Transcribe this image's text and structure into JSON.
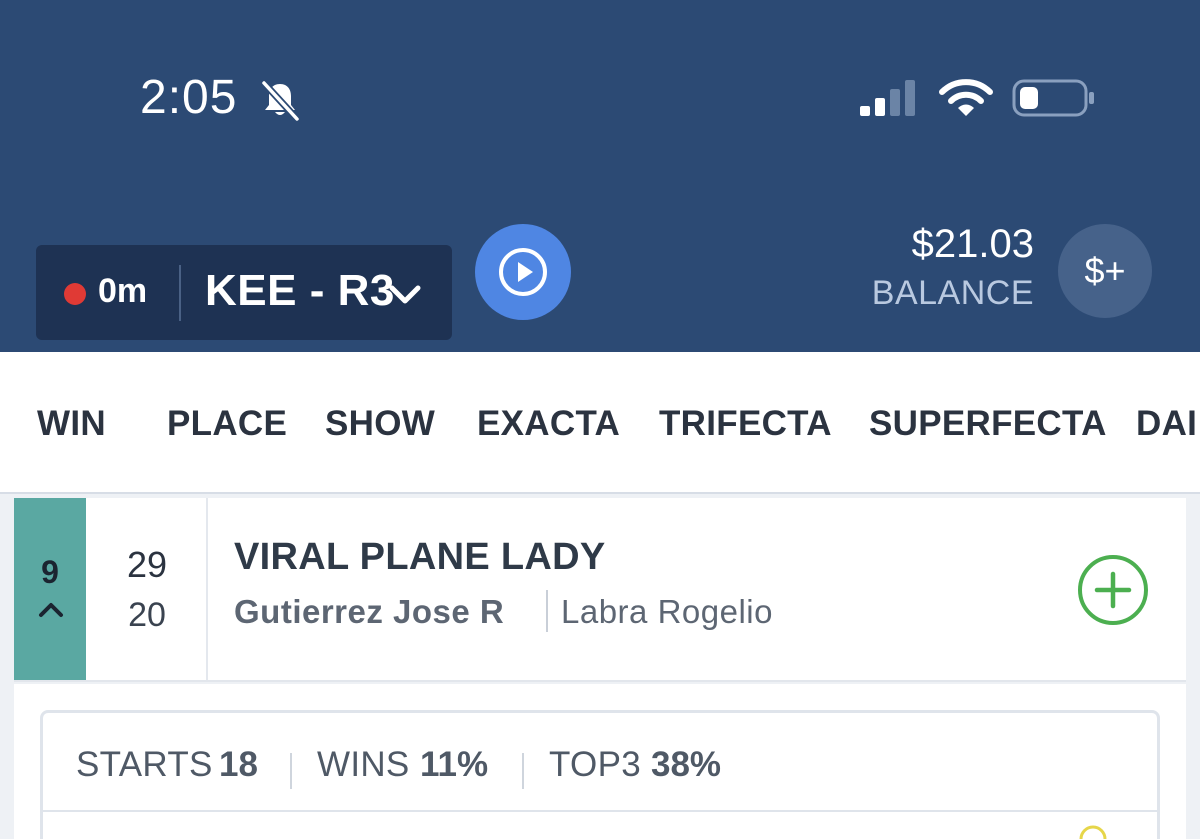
{
  "status_bar": {
    "time": "2:05",
    "icons": [
      "bell-slash-icon",
      "signal-icon",
      "wifi-icon",
      "battery-icon"
    ]
  },
  "race_selector": {
    "mtp": "0m",
    "race": "KEE - R3",
    "status_color": "#e03a35"
  },
  "balance": {
    "amount": "$21.03",
    "label": "BALANCE",
    "deposit_label": "$+"
  },
  "bet_tabs": [
    "WIN",
    "PLACE",
    "SHOW",
    "EXACTA",
    "TRIFECTA",
    "SUPERFECTA",
    "DAI"
  ],
  "runner": {
    "post": "9",
    "odds_numerator": "29",
    "odds_denominator": "20",
    "name": "VIRAL PLANE LADY",
    "jockey": "Gutierrez Jose R",
    "trainer": "Labra Rogelio",
    "post_color": "#5aa8a2"
  },
  "stats": {
    "starts_label": "STARTS",
    "starts_value": "18",
    "wins_label": "WINS",
    "wins_value": "11%",
    "top3_label": "TOP3",
    "top3_value": "38%"
  },
  "colors": {
    "header": "#2c4a74",
    "play_button": "#4f86e3",
    "add_button": "#4caf50"
  }
}
